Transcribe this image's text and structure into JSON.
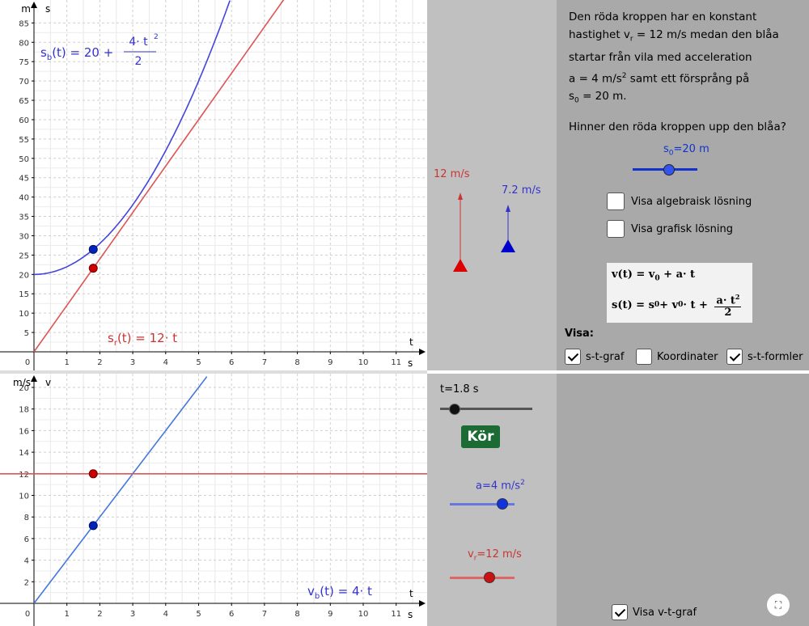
{
  "graph_top": {
    "y_unit": "m",
    "y_name": "s",
    "x_unit": "s",
    "x_name": "t",
    "x_ticks": [
      "0",
      "1",
      "2",
      "3",
      "4",
      "5",
      "6",
      "7",
      "8",
      "9",
      "10",
      "11",
      "1"
    ],
    "y_ticks": [
      "5",
      "10",
      "15",
      "20",
      "25",
      "30",
      "35",
      "40",
      "45",
      "50",
      "55",
      "60",
      "65",
      "70",
      "75",
      "80",
      "85"
    ],
    "blue_label_lhs": "s",
    "blue_label_sub": "b",
    "blue_label_rhs": "(t) = 20 + ",
    "blue_num": "4· t",
    "blue_num_exp": "2",
    "blue_den": "2",
    "red_label_lhs": "s",
    "red_label_sub": "r",
    "red_label_rhs": "(t) = 12· t"
  },
  "graph_bottom": {
    "y_unit": "m/s",
    "y_name": "v",
    "x_unit": "s",
    "x_name": "t",
    "x_ticks": [
      "0",
      "1",
      "2",
      "3",
      "4",
      "5",
      "6",
      "7",
      "8",
      "9",
      "10",
      "11",
      "1"
    ],
    "y_ticks": [
      "2",
      "4",
      "6",
      "8",
      "10",
      "12",
      "14",
      "16",
      "18",
      "20"
    ],
    "blue_label_lhs": "v",
    "blue_label_sub": "b",
    "blue_label_rhs": "(t) = 4· t"
  },
  "chart_data": [
    {
      "type": "line",
      "xlabel": "t",
      "ylabel": "s",
      "xlim": [
        0,
        12
      ],
      "ylim": [
        0,
        88
      ],
      "series": [
        {
          "name": "s_b(t) = 20 + 4·t²/2",
          "x": [
            0,
            1,
            2,
            3,
            4,
            5,
            6
          ],
          "y": [
            20,
            22,
            28,
            38,
            52,
            70,
            92
          ]
        },
        {
          "name": "s_r(t) = 12·t",
          "x": [
            0,
            7.5
          ],
          "y": [
            0,
            90
          ]
        }
      ],
      "points": [
        {
          "series": "blue",
          "t": 1.8,
          "value": 26.48
        },
        {
          "series": "red",
          "t": 1.8,
          "value": 21.6
        }
      ]
    },
    {
      "type": "line",
      "xlabel": "t",
      "ylabel": "v",
      "xlim": [
        0,
        12
      ],
      "ylim": [
        0,
        21
      ],
      "series": [
        {
          "name": "v_b(t) = 4·t",
          "x": [
            0,
            5.3
          ],
          "y": [
            0,
            21.2
          ]
        },
        {
          "name": "red",
          "x": [
            0,
            12
          ],
          "y": [
            12,
            12
          ]
        }
      ],
      "points": [
        {
          "series": "blue",
          "t": 1.8,
          "value": 7.2
        },
        {
          "series": "red",
          "t": 1.8,
          "value": 12
        }
      ]
    }
  ],
  "simulation": {
    "red_velocity_label": "12 m/s",
    "blue_velocity_label": "7.2 m/s"
  },
  "controls": {
    "t_label": "t=1.8 s",
    "t_value": 1.8,
    "t_range": [
      0,
      12
    ],
    "run_button": "Kör",
    "a_label": "a=4 m/s",
    "a_exp": "2",
    "a_fraction": 0.8,
    "vr_label_pre": "v",
    "vr_label_sub": "r",
    "vr_label_post": "=12 m/s",
    "vr_fraction": 0.6
  },
  "info": {
    "line1": "Den röda kroppen har en konstant",
    "line2_pre": "hastighet v",
    "line2_sub": "r",
    "line2_post": " = 12 m/s medan den blåa",
    "line3": "startar från vila med acceleration",
    "line4_pre": "a = 4 m/s",
    "line4_exp": "2",
    "line4_post": " samt ett försprång på",
    "line5_pre": "s",
    "line5_sub": "0",
    "line5_post": " = 20 m.",
    "question": "Hinner den röda kroppen upp den blåa?",
    "s0_label_pre": "s",
    "s0_label_sub": "0",
    "s0_label_post": "=20 m",
    "s0_fraction": 0.55,
    "cb_algebra": "Visa algebraisk lösning",
    "cb_graphic": "Visa grafisk lösning",
    "formula_v": "v(t) = v",
    "formula_v_sub": "0",
    "formula_v_rest": " + a· t",
    "formula_s": "s(t) = s",
    "formula_s_sub0": "0",
    "formula_s_mid": " + v",
    "formula_s_sub1": "0",
    "formula_s_rest": "· t + ",
    "formula_s_num": "a· t",
    "formula_s_num_exp": "2",
    "formula_s_den": "2",
    "visa_label": "Visa:",
    "cb_st": "s-t-graf",
    "cb_coord": "Koordinater",
    "cb_stform": "s-t-formler",
    "cb_vt": "Visa v-t-graf"
  },
  "colors": {
    "blue": "#3333cc",
    "red": "#cc3333",
    "red_dot": "#cc0000",
    "blue_dot": "#0022bb",
    "line_blue": "#4466cc",
    "line_red": "#cc4444",
    "button_green": "#1c6b34",
    "panel_mid": "#c0c0c0",
    "panel_right": "#a9a9a9"
  }
}
